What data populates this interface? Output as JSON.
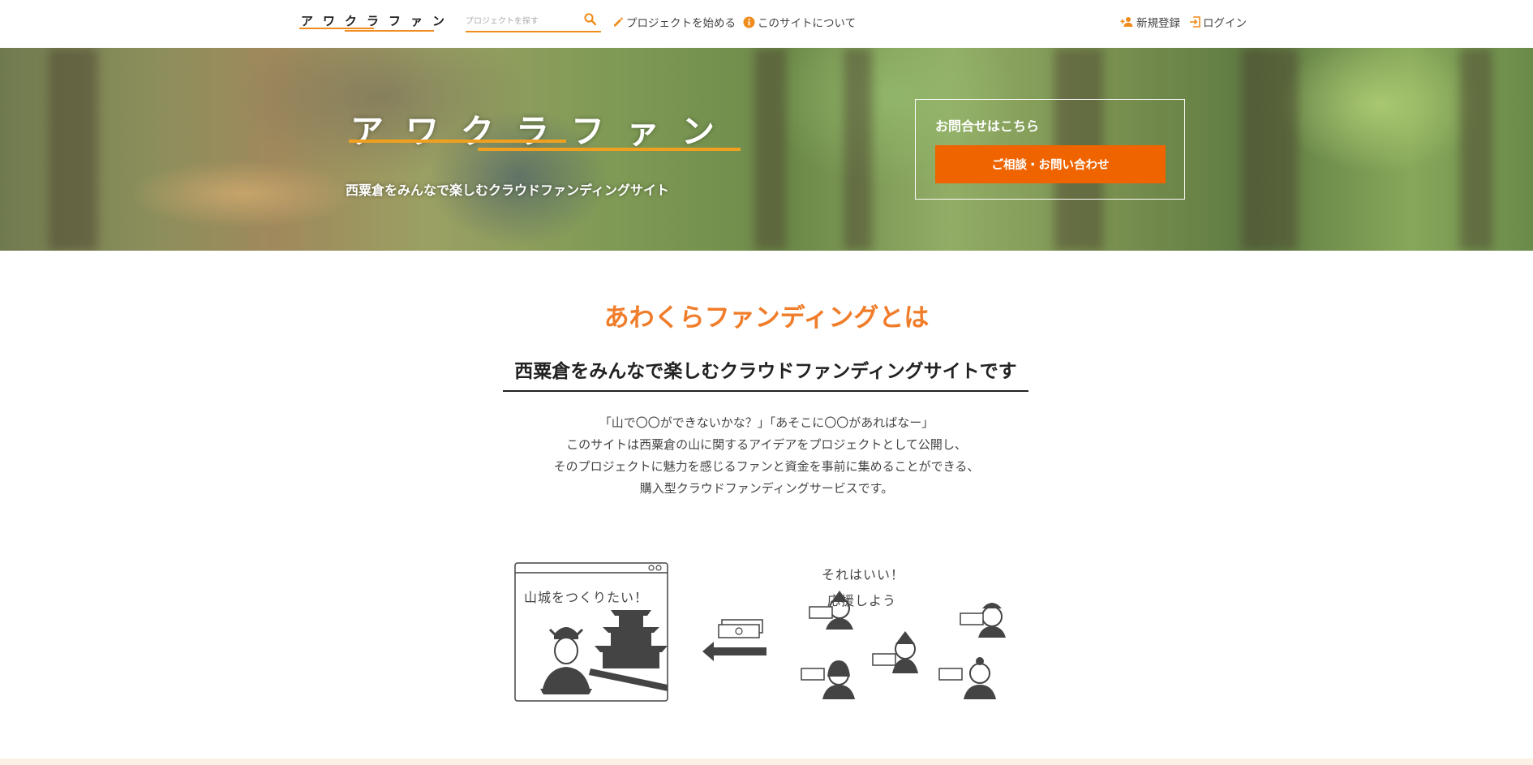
{
  "header": {
    "logo_text": "アワクラファン",
    "search_placeholder": "プロジェクトを探す",
    "nav": {
      "start_project": "プロジェクトを始める",
      "about_site": "このサイトについて",
      "register": "新規登録",
      "login": "ログイン"
    }
  },
  "hero": {
    "title": "アワクラファン",
    "subtitle": "西粟倉をみんなで楽しむクラウドファンディングサイト",
    "contact_label": "お問合せはこちら",
    "contact_button": "ご相談・お問い合わせ"
  },
  "about": {
    "heading": "あわくらファンディングとは",
    "subheading": "西粟倉をみんなで楽しむクラウドファンディングサイトです",
    "lines": [
      "「山で〇〇ができないかな？」「あそこに〇〇があればなー」",
      "このサイトは西粟倉の山に関するアイデアをプロジェクトとして公開し、",
      "そのプロジェクトに魅力を感じるファンと資金を事前に集めることができる、",
      "購入型クラウドファンディングサービスです。"
    ],
    "illustration": {
      "window_text": "山城をつくりたい！",
      "caption_line1": "それはいい！",
      "caption_line2": "応援しよう"
    }
  },
  "colors": {
    "accent_orange": "#f08c1e",
    "button_orange": "#f06400",
    "heading_orange": "#f07d2a"
  }
}
